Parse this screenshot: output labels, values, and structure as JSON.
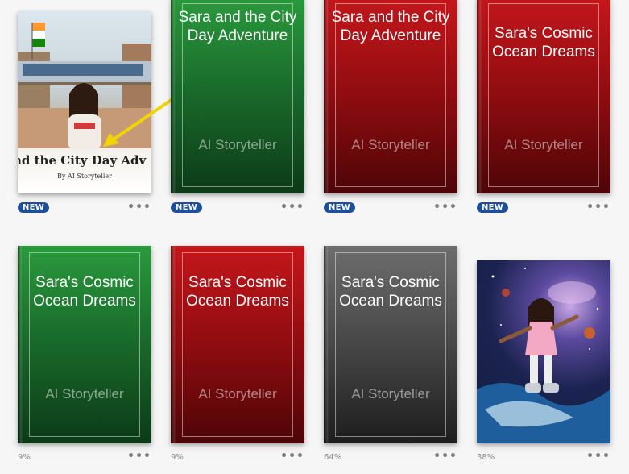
{
  "books": [
    {
      "id": "b1",
      "title": "Sara and the City Day Adventure",
      "cover_title_text": "nd the City Day Adv",
      "byline": "By AI Storyteller",
      "status": "NEW",
      "more": "•••",
      "style": "illustrated-city"
    },
    {
      "id": "b2",
      "title": "Sara and the City Day Adventure",
      "author": "AI Storyteller",
      "status": "NEW",
      "more": "•••",
      "color": "green"
    },
    {
      "id": "b3",
      "title": "Sara and the City Day Adventure",
      "author": "AI Storyteller",
      "status": "NEW",
      "more": "•••",
      "color": "red"
    },
    {
      "id": "b4",
      "title": "Sara's Cosmic Ocean Dreams",
      "author": "AI Storyteller",
      "status": "NEW",
      "more": "•••",
      "color": "red"
    },
    {
      "id": "b5",
      "title": "Sara's Cosmic Ocean Dreams",
      "author": "AI Storyteller",
      "progress": "9%",
      "more": "•••",
      "color": "green"
    },
    {
      "id": "b6",
      "title": "Sara's Cosmic Ocean Dreams",
      "author": "AI Storyteller",
      "progress": "9%",
      "more": "•••",
      "color": "red"
    },
    {
      "id": "b7",
      "title": "Sara's Cosmic Ocean Dreams",
      "author": "AI Storyteller",
      "progress": "64%",
      "more": "•••",
      "color": "gray"
    },
    {
      "id": "b8",
      "title": "Sara's Cosmic Ocean Dreams",
      "progress": "38%",
      "more": "•••",
      "style": "illustrated-cosmic"
    }
  ],
  "colors": {
    "badge": "#1d4f9c",
    "green": "#1a6d2c",
    "red": "#8f0c10",
    "gray": "#474747",
    "arrow": "#f2d400"
  }
}
